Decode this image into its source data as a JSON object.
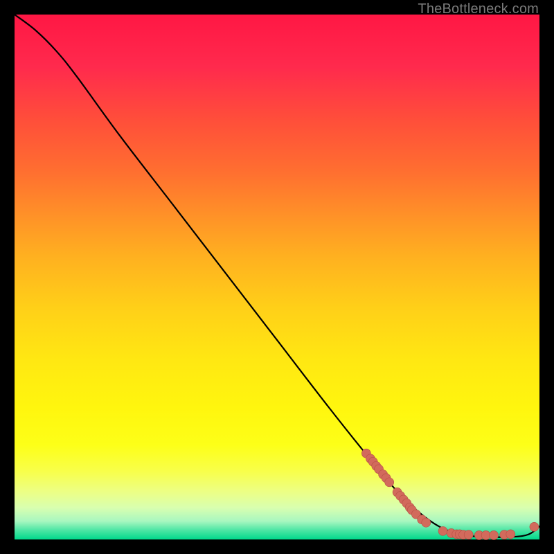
{
  "watermark": "TheBottleneck.com",
  "colors": {
    "page_bg": "#000000",
    "curve": "#000000",
    "marker_fill": "#d26a5c",
    "marker_stroke": "#b54f44"
  },
  "chart_data": {
    "type": "line",
    "title": "",
    "xlabel": "",
    "ylabel": "",
    "xlim": [
      0,
      100
    ],
    "ylim": [
      0,
      100
    ],
    "grid": false,
    "legend": false,
    "curve": [
      {
        "x": 0,
        "y": 100
      },
      {
        "x": 4,
        "y": 97
      },
      {
        "x": 8,
        "y": 93
      },
      {
        "x": 12,
        "y": 88
      },
      {
        "x": 20,
        "y": 77
      },
      {
        "x": 30,
        "y": 64
      },
      {
        "x": 40,
        "y": 51
      },
      {
        "x": 50,
        "y": 38
      },
      {
        "x": 60,
        "y": 25
      },
      {
        "x": 68,
        "y": 15
      },
      {
        "x": 74,
        "y": 8
      },
      {
        "x": 80,
        "y": 3
      },
      {
        "x": 85,
        "y": 1
      },
      {
        "x": 90,
        "y": 0.5
      },
      {
        "x": 95,
        "y": 0.5
      },
      {
        "x": 98,
        "y": 1
      },
      {
        "x": 100,
        "y": 2.5
      }
    ],
    "series": [
      {
        "name": "points",
        "x": [
          67.0,
          67.8,
          68.3,
          68.9,
          69.4,
          70.2,
          70.8,
          71.4,
          72.9,
          73.5,
          74.1,
          74.7,
          75.3,
          75.7,
          76.5,
          77.6,
          78.4,
          81.6,
          83.2,
          84.2,
          84.8,
          85.5,
          86.5,
          88.5,
          89.8,
          91.3,
          93.3,
          94.5,
          99.0
        ],
        "y": [
          16.4,
          15.4,
          14.8,
          14.0,
          13.4,
          12.4,
          11.7,
          10.9,
          9.0,
          8.3,
          7.6,
          6.9,
          6.1,
          5.6,
          4.8,
          3.8,
          3.2,
          1.6,
          1.2,
          1.0,
          1.0,
          0.9,
          0.9,
          0.8,
          0.8,
          0.8,
          0.9,
          1.0,
          2.4
        ]
      }
    ]
  }
}
